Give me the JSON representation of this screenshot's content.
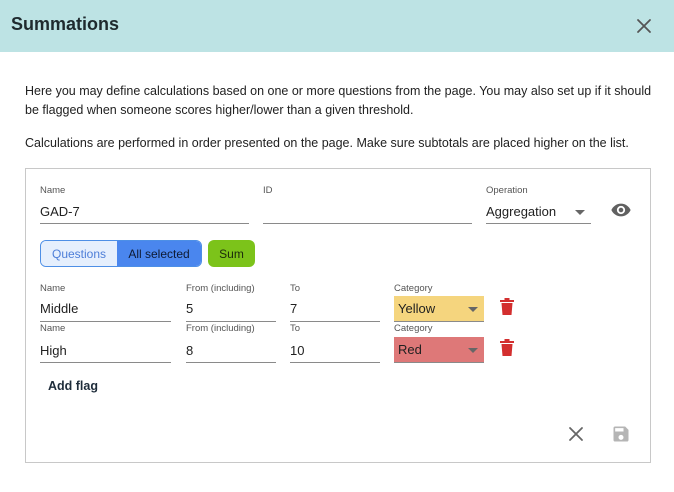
{
  "dialog": {
    "title": "Summations",
    "close_icon": "close-icon"
  },
  "description": {
    "line1": "Here you may define calculations based on one or more questions from the page. You may also set up if it should be flagged when someone scores higher/lower than a given threshold.",
    "line2": "Calculations are performed in order presented on the page. Make sure subtotals are placed higher on the list."
  },
  "calculation": {
    "name_label": "Name",
    "name_value": "GAD-7",
    "id_label": "ID",
    "id_value": "",
    "operation_label": "Operation",
    "operation_value": "Aggregation",
    "visibility_icon": "eye-icon",
    "toggle": {
      "questions_label": "Questions",
      "all_selected_label": "All selected"
    },
    "sum_label": "Sum"
  },
  "flags": [
    {
      "name_label": "Name",
      "name_value": "Middle",
      "from_label": "From (including)",
      "from_value": "5",
      "to_label": "To",
      "to_value": "7",
      "category_label": "Category",
      "category_value": "Yellow",
      "category_color": "#f5d57e"
    },
    {
      "name_label": "Name",
      "name_value": "High",
      "from_label": "From (including)",
      "from_value": "8",
      "to_label": "To",
      "to_value": "10",
      "category_label": "Category",
      "category_value": "Red",
      "category_color": "#de7878"
    }
  ],
  "add_flag_label": "Add flag",
  "footer": {
    "cancel_icon": "close-icon",
    "save_icon": "save-icon"
  },
  "colors": {
    "header_bg": "#bde3e4",
    "delete_red": "#d32f2f",
    "toggle_blue": "#4a86ee",
    "sum_green": "#7cc31a"
  }
}
